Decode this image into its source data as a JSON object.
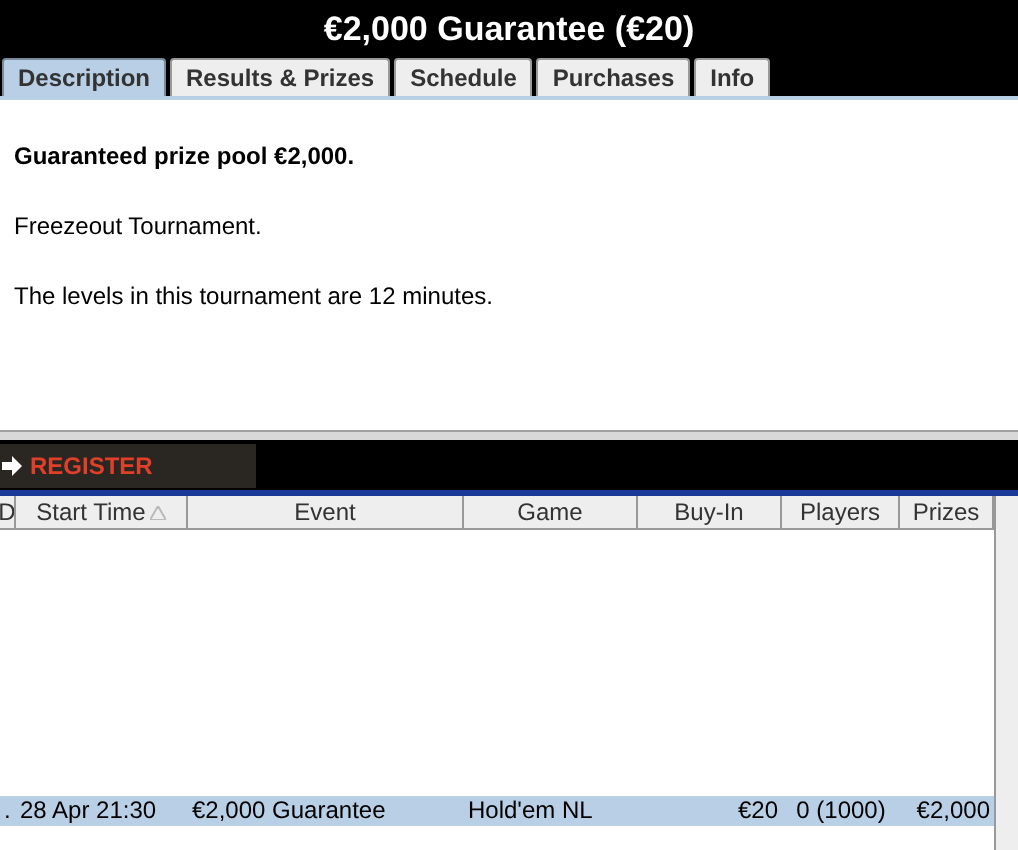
{
  "window": {
    "title": "€2,000 Guarantee (€20)"
  },
  "tabs": [
    {
      "label": "Description",
      "selected": true
    },
    {
      "label": "Results & Prizes",
      "selected": false
    },
    {
      "label": "Schedule",
      "selected": false
    },
    {
      "label": "Purchases",
      "selected": false
    },
    {
      "label": "Info",
      "selected": false
    }
  ],
  "description": {
    "heading": "Guaranteed prize pool €2,000.",
    "paragraphs": [
      "Freezeout Tournament.",
      "The levels in this tournament are 12 minutes."
    ]
  },
  "register_button": {
    "label": "REGISTER"
  },
  "table": {
    "columns": [
      "D",
      "Start Time",
      "Event",
      "Game",
      "Buy-In",
      "Players",
      "Prizes"
    ],
    "rows": [
      {
        "cells": [
          ".",
          "28 Apr 21:30",
          "€2,000 Guarantee",
          "Hold'em NL",
          "€20",
          "0 (1000)",
          "€2,000"
        ],
        "selected": true
      }
    ]
  }
}
